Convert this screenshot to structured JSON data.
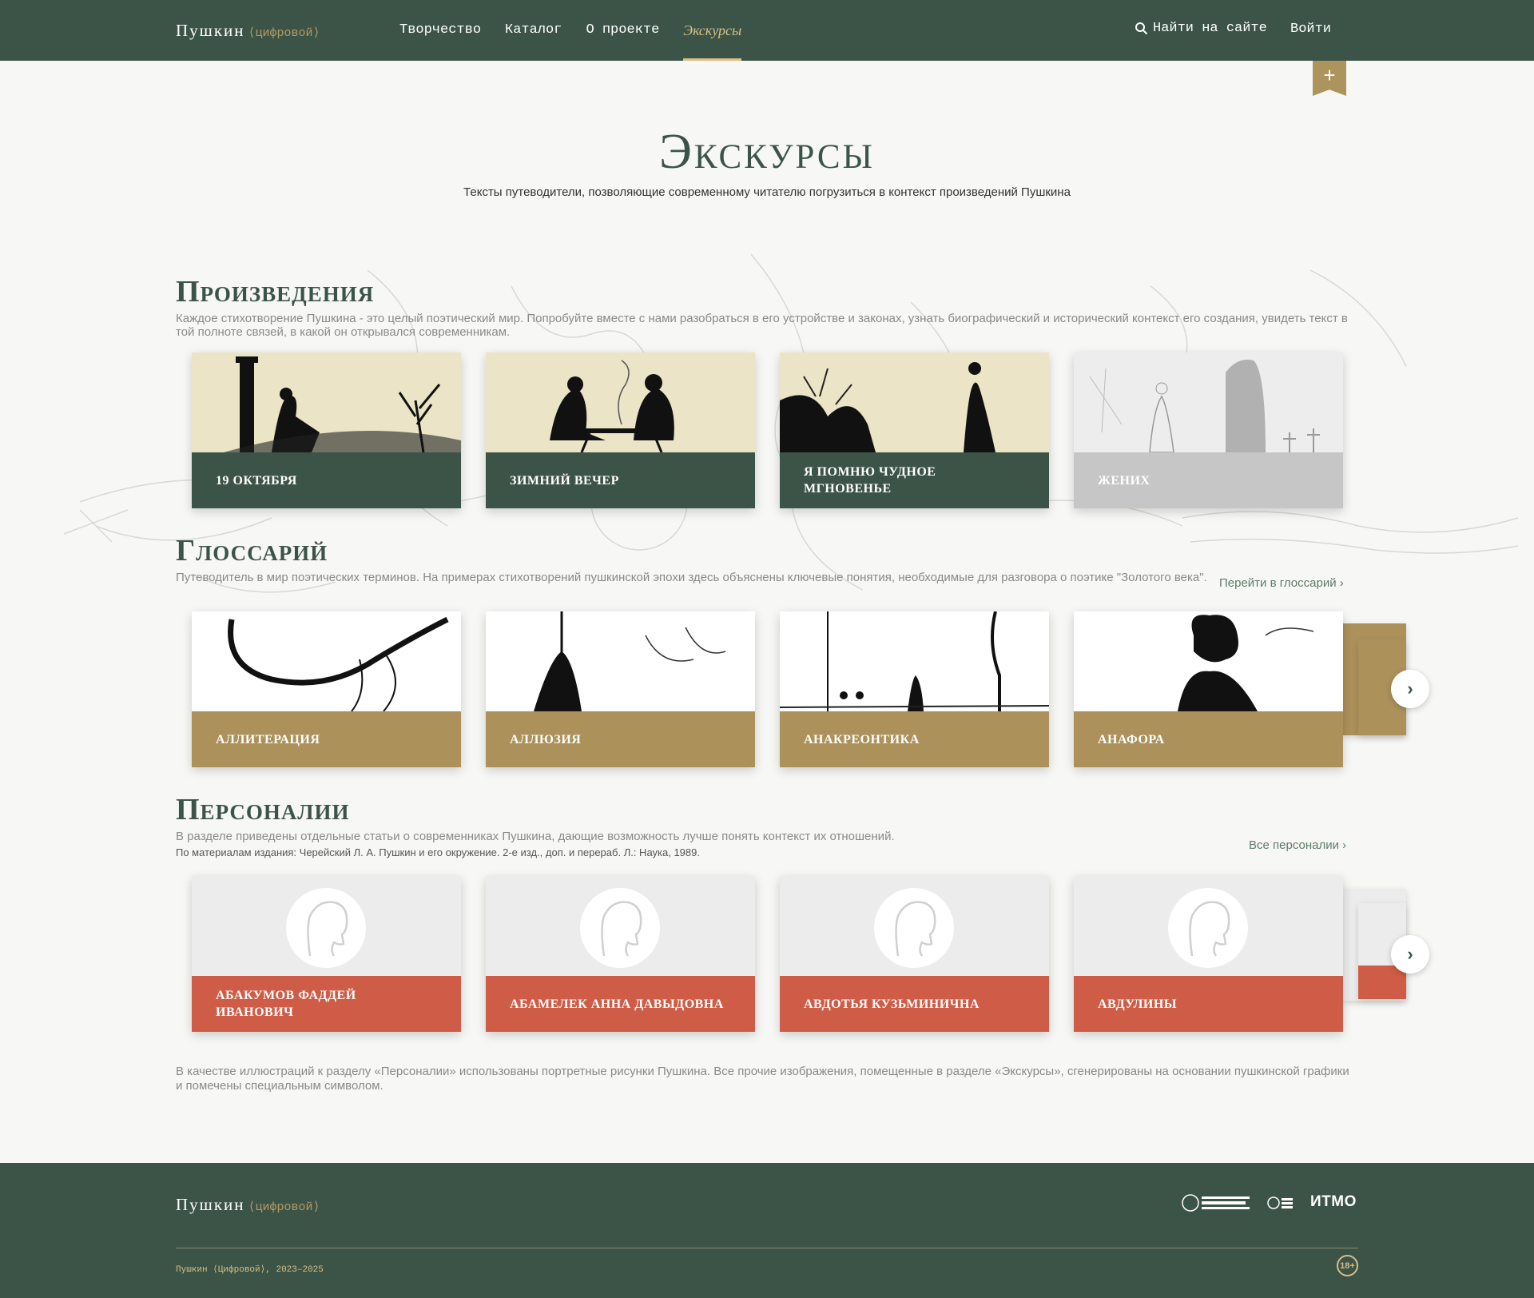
{
  "header": {
    "logo": "Пушкин",
    "logo_tag": "⟨цифровой⟩",
    "nav": [
      "Творчество",
      "Каталог",
      "О проекте",
      "Экскурсы"
    ],
    "search": "Найти на сайте",
    "login": "Войти"
  },
  "page": {
    "title": "Экскурсы",
    "subtitle": "Тексты путеводители, позволяющие современному читателю погрузиться в контекст произведений Пушкина"
  },
  "works": {
    "title": "Произведения",
    "desc": "Каждое стихотворение Пушкина - это целый поэтический мир. Попробуйте вместе с нами разобраться в его устройстве и законах, узнать биографический и исторический контекст его создания, увидеть текст в той полноте связей, в какой он открывался современникам.",
    "cards": [
      "19 октября",
      "Зимний вечер",
      "Я помню чудное мгновенье",
      "Жених"
    ]
  },
  "glossary": {
    "title": "Глоссарий",
    "desc": "Путеводитель в мир поэтических терминов. На примерах стихотворений пушкинской эпохи здесь объяснены ключевые понятия, необходимые для разговора о поэтике \"Золотого века\".",
    "link": "Перейти в глоссарий",
    "cards": [
      "Аллитерация",
      "Аллюзия",
      "Анакреонтика",
      "Анафора"
    ]
  },
  "persons": {
    "title": "Персоналии",
    "desc": "В разделе приведены отдельные статьи о современниках Пушкина, дающие возможность лучше понять контекст их отношений.",
    "note": "По материалам издания: Черейский Л. А. Пушкин и его окружение. 2-е изд., доп. и перераб. Л.: Наука, 1989.",
    "link": "Все персоналии",
    "cards": [
      "Абакумов Фаддей Иванович",
      "Абамелек Анна Давыдовна",
      "Авдотья Кузьминична",
      "Авдулины"
    ]
  },
  "footnote": "В качестве иллюстраций к разделу «Персоналии» использованы портретные рисунки Пушкина. Все прочие изображения, помещенные в разделе «Экскурсы», сгенерированы на основании пушкинской графики и помечены специальным символом.",
  "footer": {
    "logo": "Пушкин",
    "logo_tag": "⟨цифровой⟩",
    "copyright": "Пушкин ⟨Цифровой⟩, 2023–2025",
    "partner_itmo": "ИТМО",
    "age": "18+"
  }
}
